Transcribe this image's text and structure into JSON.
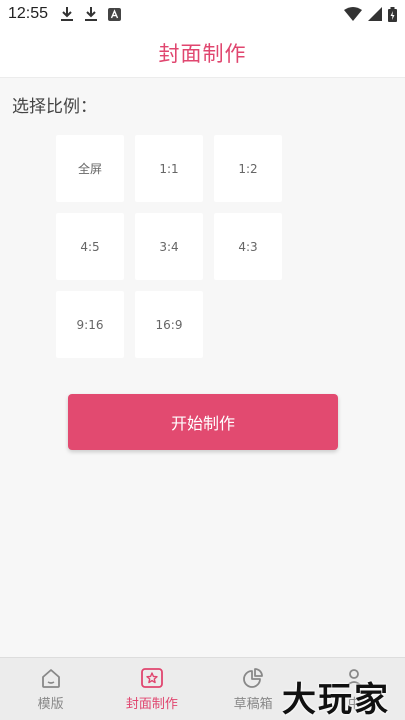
{
  "status_bar": {
    "time": "12:55",
    "icons_left": [
      "download-icon",
      "download-icon",
      "text-box-icon"
    ],
    "icons_right": [
      "wifi-icon",
      "signal-icon",
      "battery-icon"
    ]
  },
  "header": {
    "title": "封面制作"
  },
  "main": {
    "section_label": "选择比例：",
    "ratios": [
      "全屏",
      "1:1",
      "1:2",
      "4:5",
      "3:4",
      "4:3",
      "9:16",
      "16:9"
    ],
    "start_button": "开始制作"
  },
  "tabs": [
    {
      "label": "模版",
      "icon": "home-icon",
      "active": false
    },
    {
      "label": "封面制作",
      "icon": "cover-icon",
      "active": true
    },
    {
      "label": "草稿箱",
      "icon": "pie-chart-icon",
      "active": false
    },
    {
      "label": "中",
      "icon": "user-icon",
      "active": false
    }
  ],
  "watermark": "大玩家",
  "colors": {
    "accent": "#e0466f",
    "button": "#e24a70",
    "background": "#f7f7f7"
  }
}
